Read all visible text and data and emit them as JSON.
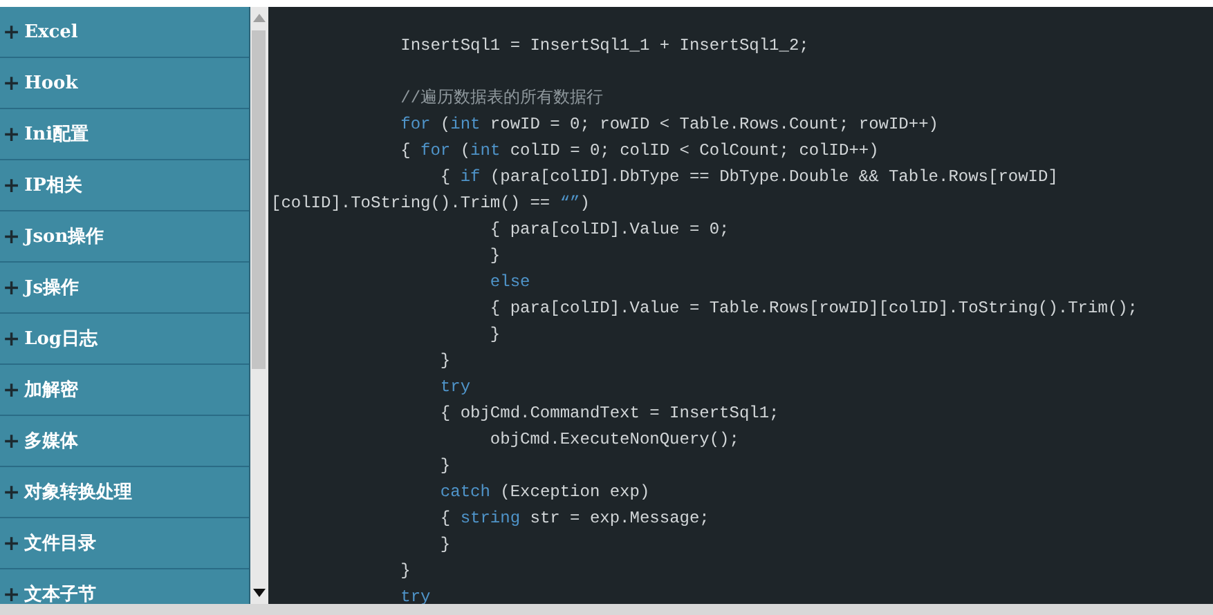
{
  "sidebar": {
    "items": [
      {
        "icon": "+",
        "label": "Excel"
      },
      {
        "icon": "+",
        "label": "Hook"
      },
      {
        "icon": "+",
        "label": "Ini配置"
      },
      {
        "icon": "+",
        "label": "IP相关"
      },
      {
        "icon": "+",
        "label": "Json操作"
      },
      {
        "icon": "+",
        "label": "Js操作"
      },
      {
        "icon": "+",
        "label": "Log日志"
      },
      {
        "icon": "+",
        "label": "加解密"
      },
      {
        "icon": "+",
        "label": "多媒体"
      },
      {
        "icon": "+",
        "label": "对象转换处理"
      },
      {
        "icon": "+",
        "label": "文件目录"
      },
      {
        "icon": "+",
        "label": "文本子节"
      }
    ]
  },
  "code": {
    "lines": [
      {
        "kind": "code",
        "segments": [
          {
            "kind": "plain",
            "text": "             InsertSql1 = InsertSql1_1 + InsertSql1_2;"
          }
        ]
      },
      {
        "kind": "blank"
      },
      {
        "kind": "code",
        "segments": [
          {
            "kind": "comment",
            "text": "             //遍历数据表的所有数据行"
          }
        ]
      },
      {
        "kind": "code",
        "segments": [
          {
            "kind": "keyword",
            "text": "             for"
          },
          {
            "kind": "plain",
            "text": " ("
          },
          {
            "kind": "keyword",
            "text": "int"
          },
          {
            "kind": "plain",
            "text": " rowID = 0; rowID < Table.Rows.Count; rowID++)"
          }
        ]
      },
      {
        "kind": "code",
        "segments": [
          {
            "kind": "plain",
            "text": "             { "
          },
          {
            "kind": "keyword",
            "text": "for"
          },
          {
            "kind": "plain",
            "text": " ("
          },
          {
            "kind": "keyword",
            "text": "int"
          },
          {
            "kind": "plain",
            "text": " colID = 0; colID < ColCount; colID++)"
          }
        ]
      },
      {
        "kind": "code",
        "segments": [
          {
            "kind": "plain",
            "text": "                 { "
          },
          {
            "kind": "keyword",
            "text": "if"
          },
          {
            "kind": "plain",
            "text": " (para[colID].DbType == DbType.Double && Table.Rows[rowID]"
          }
        ]
      },
      {
        "kind": "code",
        "segments": [
          {
            "kind": "plain",
            "text": "[colID].ToString().Trim() == "
          },
          {
            "kind": "string",
            "text": "“”"
          },
          {
            "kind": "plain",
            "text": ")"
          }
        ]
      },
      {
        "kind": "code",
        "segments": [
          {
            "kind": "plain",
            "text": "                      { para[colID].Value = 0;"
          }
        ]
      },
      {
        "kind": "code",
        "segments": [
          {
            "kind": "plain",
            "text": "                      }"
          }
        ]
      },
      {
        "kind": "code",
        "segments": [
          {
            "kind": "keyword",
            "text": "                      else"
          }
        ]
      },
      {
        "kind": "code",
        "segments": [
          {
            "kind": "plain",
            "text": "                      { para[colID].Value = Table.Rows[rowID][colID].ToString().Trim();"
          }
        ]
      },
      {
        "kind": "code",
        "segments": [
          {
            "kind": "plain",
            "text": "                      }"
          }
        ]
      },
      {
        "kind": "code",
        "segments": [
          {
            "kind": "plain",
            "text": "                 }"
          }
        ]
      },
      {
        "kind": "code",
        "segments": [
          {
            "kind": "keyword",
            "text": "                 try"
          }
        ]
      },
      {
        "kind": "code",
        "segments": [
          {
            "kind": "plain",
            "text": "                 { objCmd.CommandText = InsertSql1;"
          }
        ]
      },
      {
        "kind": "code",
        "segments": [
          {
            "kind": "plain",
            "text": "                      objCmd.ExecuteNonQuery();"
          }
        ]
      },
      {
        "kind": "code",
        "segments": [
          {
            "kind": "plain",
            "text": "                 }"
          }
        ]
      },
      {
        "kind": "code",
        "segments": [
          {
            "kind": "keyword",
            "text": "                 catch"
          },
          {
            "kind": "plain",
            "text": " (Exception exp)"
          }
        ]
      },
      {
        "kind": "code",
        "segments": [
          {
            "kind": "plain",
            "text": "                 { "
          },
          {
            "kind": "keyword",
            "text": "string"
          },
          {
            "kind": "plain",
            "text": " str = exp.Message;"
          }
        ]
      },
      {
        "kind": "code",
        "segments": [
          {
            "kind": "plain",
            "text": "                 }"
          }
        ]
      },
      {
        "kind": "code",
        "segments": [
          {
            "kind": "plain",
            "text": "             }"
          }
        ]
      },
      {
        "kind": "code",
        "segments": [
          {
            "kind": "keyword",
            "text": "             try"
          }
        ]
      }
    ]
  }
}
